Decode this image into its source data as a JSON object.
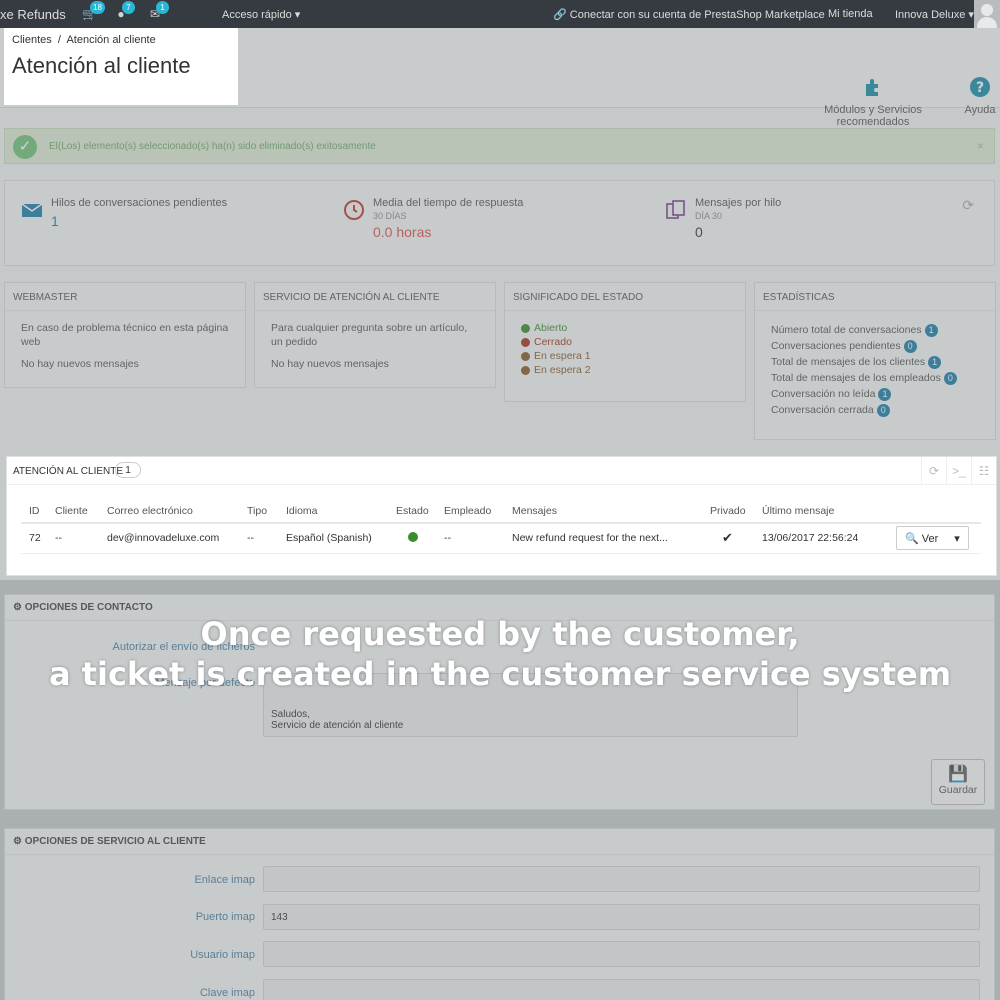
{
  "topbar": {
    "brand": "xe Refunds",
    "badges": {
      "orders": "18",
      "customers": "7",
      "messages": "1"
    },
    "quick_access": "Acceso rápido",
    "marketplace": "Conectar con su cuenta de PrestaShop Marketplace",
    "my_store": "Mi tienda",
    "user": "Innova Deluxe"
  },
  "header": {
    "breadcrumb_parent": "Clientes",
    "breadcrumb_sep": "/",
    "breadcrumb_current": "Atención al cliente",
    "title": "Atención al cliente",
    "modules_btn": "Módulos y Servicios recomendados",
    "help_btn": "Ayuda"
  },
  "alert": {
    "message": "El(Los) elemento(s) seleccionado(s) ha(n) sido eliminado(s) exitosamente",
    "close": "×"
  },
  "kpi": {
    "pending_label": "Hilos de conversaciones pendientes",
    "pending_value": "1",
    "response_label": "Media del tiempo de respuesta",
    "response_sub": "30 DÍAS",
    "response_value": "0.0 horas",
    "per_thread_label": "Mensajes por hilo",
    "per_thread_sub": "DÍA 30",
    "per_thread_value": "0"
  },
  "panels": {
    "webmaster": {
      "title": "WEBMASTER",
      "text": "En caso de problema técnico en esta página web",
      "none": "No hay nuevos mensajes"
    },
    "service": {
      "title": "SERVICIO DE ATENCIÓN AL CLIENTE",
      "text": "Para cualquier pregunta sobre un artículo, un pedido",
      "none": "No hay nuevos mensajes"
    },
    "status": {
      "title": "SIGNIFICADO DEL ESTADO",
      "items": [
        {
          "label": "Abierto",
          "color": "#3d8b2f"
        },
        {
          "label": "Cerrado",
          "color": "#a8331d"
        },
        {
          "label": "En espera 1",
          "color": "#8a5a2b"
        },
        {
          "label": "En espera 2",
          "color": "#8a5a2b"
        }
      ]
    },
    "stats": {
      "title": "ESTADÍSTICAS",
      "items": [
        {
          "label": "Número total de conversaciones",
          "value": "1"
        },
        {
          "label": "Conversaciones pendientes",
          "value": "0"
        },
        {
          "label": "Total de mensajes de los clientes",
          "value": "1"
        },
        {
          "label": "Total de mensajes de los empleados",
          "value": "0"
        },
        {
          "label": "Conversación no leída",
          "value": "1"
        },
        {
          "label": "Conversación cerrada",
          "value": "0"
        }
      ]
    }
  },
  "threads": {
    "title": "ATENCIÓN AL CLIENTE",
    "count": "1",
    "columns": [
      "ID",
      "Cliente",
      "Correo electrónico",
      "Tipo",
      "Idioma",
      "Estado",
      "Empleado",
      "Mensajes",
      "Privado",
      "Último mensaje"
    ],
    "row": {
      "id": "72",
      "customer": "--",
      "email": "dev@innovadeluxe.com",
      "type": "--",
      "language": "Español (Spanish)",
      "employee": "--",
      "message": "New refund request for the next...",
      "last": "13/06/2017 22:56:24",
      "view": "Ver"
    }
  },
  "contact": {
    "title": "OPCIONES DE CONTACTO",
    "upload_label": "Autorizar el envío de ficheros",
    "default_msg_label": "Mensaje por defecto",
    "msg_line1": "Saludos,",
    "msg_line2": "Servicio de atención al cliente",
    "save": "Guardar"
  },
  "service": {
    "title": "OPCIONES DE SERVICIO AL CLIENTE",
    "imap_url_label": "Enlace imap",
    "imap_port_label": "Puerto imap",
    "imap_port_value": "143",
    "imap_user_label": "Usuario imap",
    "imap_pass_label": "Clave imap"
  },
  "caption": {
    "line1": "Once requested by the customer,",
    "line2": "a ticket is created in the customer service system"
  }
}
